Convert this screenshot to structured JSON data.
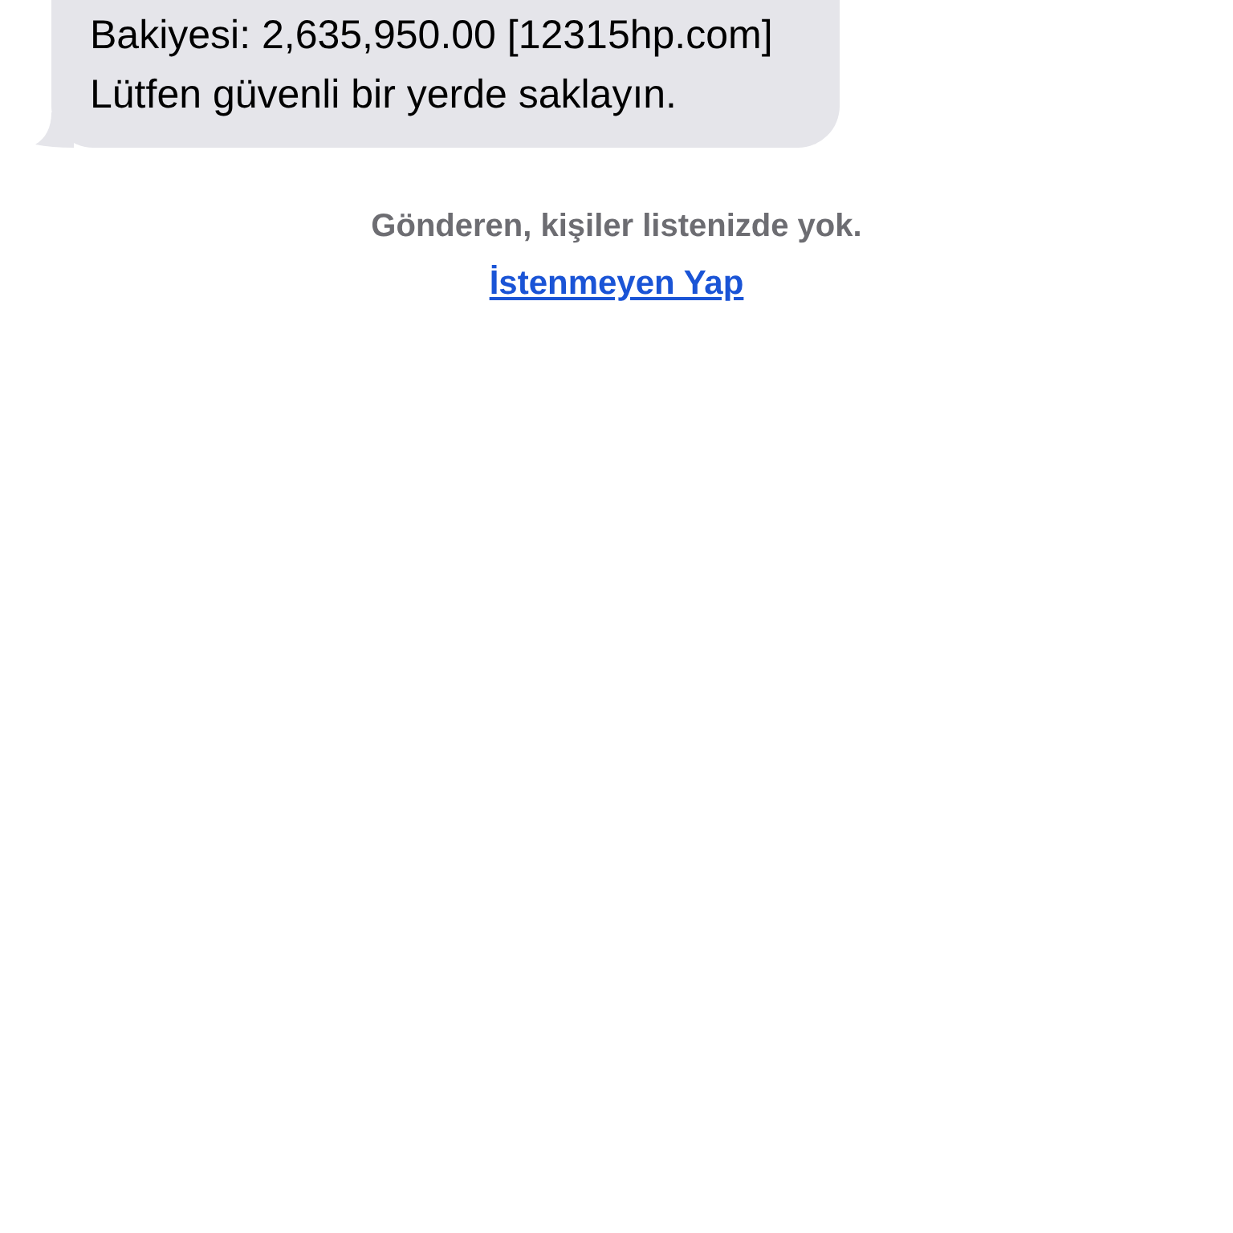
{
  "message": {
    "text": "Bakiyesi: 2,635,950.00 [12315hp.com] Lütfen güvenli bir yerde saklayın."
  },
  "notice": "Gönderen, kişiler listenizde yok.",
  "report_link": "İstenmeyen Yap"
}
